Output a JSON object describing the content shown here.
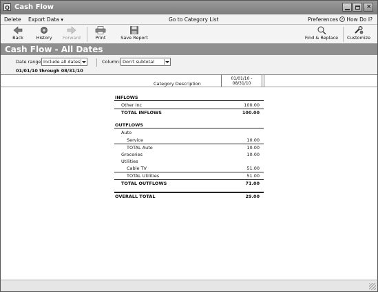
{
  "window": {
    "title": "Cash Flow",
    "logo_glyph": "Q"
  },
  "menubar": {
    "delete": "Delete",
    "export": "Export Data",
    "export_arrow": "▾",
    "goto": "Go to Category List",
    "preferences": "Preferences",
    "howdoi": "How Do I?"
  },
  "toolbar": {
    "back": "Back",
    "history": "History",
    "forward": "Forward",
    "print": "Print",
    "save": "Save Report",
    "find": "Find & Replace",
    "customize": "Customize"
  },
  "report": {
    "title": "Cash Flow - All Dates",
    "date_range_label": "Date range:",
    "date_range_value": "Include all dates",
    "column_label": "Column:",
    "column_value": "Don't subtotal",
    "date_range_text": "01/01/10 through 08/31/10",
    "col_category": "Category Description",
    "col_date_1": "01/01/10 -",
    "col_date_2": "08/31/10"
  },
  "rows": [
    {
      "label": "INFLOWS",
      "amount": ""
    },
    {
      "label": "Other Inc",
      "amount": "100.00"
    },
    {
      "label": "TOTAL INFLOWS",
      "amount": "100.00"
    },
    {
      "label": "OUTFLOWS",
      "amount": ""
    },
    {
      "label": "Auto",
      "amount": ""
    },
    {
      "label": "Service",
      "amount": "10.00"
    },
    {
      "label": "TOTAL Auto",
      "amount": "10.00"
    },
    {
      "label": "Groceries",
      "amount": "10.00"
    },
    {
      "label": "Utilities",
      "amount": ""
    },
    {
      "label": "Cable TV",
      "amount": "51.00"
    },
    {
      "label": "TOTAL Utilities",
      "amount": "51.00"
    },
    {
      "label": "TOTAL OUTFLOWS",
      "amount": "71.00"
    },
    {
      "label": "OVERALL TOTAL",
      "amount": "29.00"
    }
  ],
  "colors": {
    "titlebar": "#8a8a8a",
    "report_band": "#8f8f8f"
  }
}
